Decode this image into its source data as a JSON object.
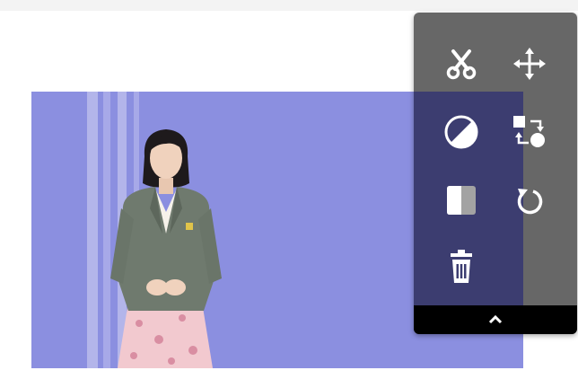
{
  "editor": {
    "canvas_color": "#8b8fe0",
    "stripe_color": "#b6b8ec"
  },
  "toolbar": {
    "background": "#676767",
    "overlap_color": "#3c3d70",
    "icon_color": "#ffffff",
    "tools": [
      {
        "id": "cut",
        "icon": "scissors-icon"
      },
      {
        "id": "move",
        "icon": "move-arrows-icon"
      },
      {
        "id": "adjust",
        "icon": "contrast-icon"
      },
      {
        "id": "replace",
        "icon": "swap-shapes-icon"
      },
      {
        "id": "flip",
        "icon": "flip-icon"
      },
      {
        "id": "rotate",
        "icon": "rotate-icon"
      },
      {
        "id": "delete",
        "icon": "trash-icon"
      }
    ],
    "collapse_icon": "chevron-up-icon"
  }
}
